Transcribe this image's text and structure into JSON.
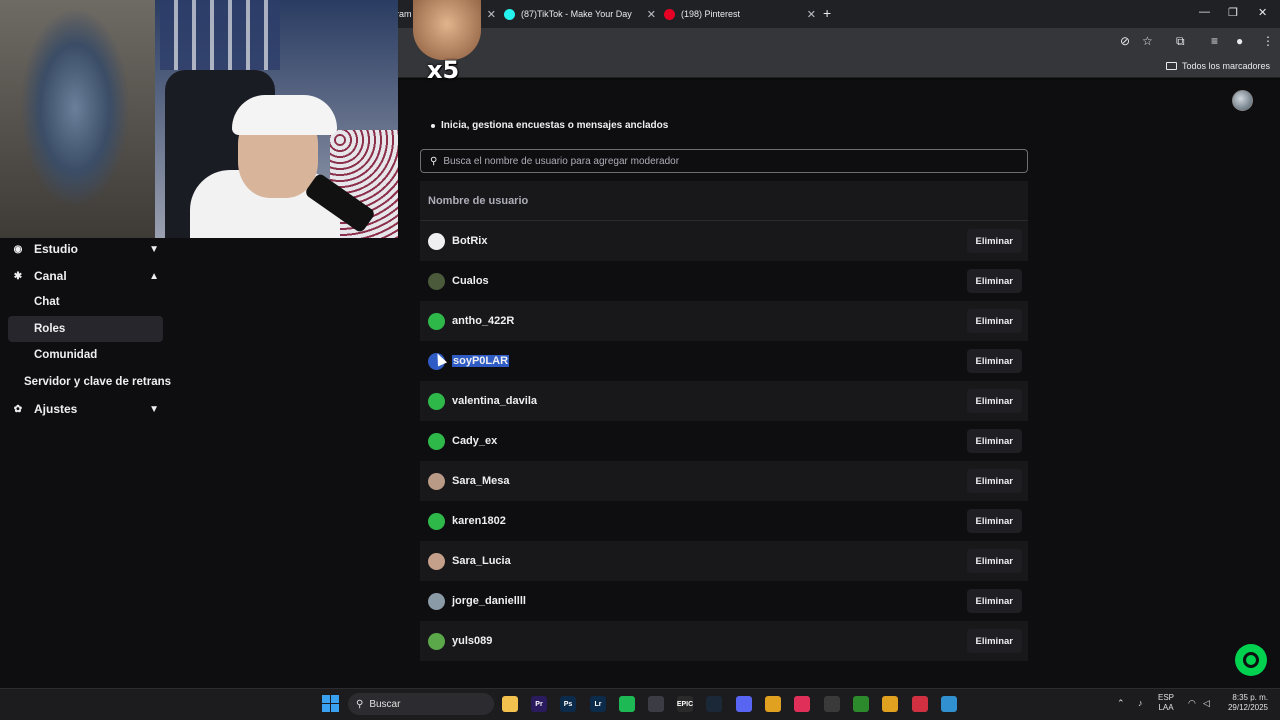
{
  "browser": {
    "tabs": [
      {
        "title": "ram",
        "icon": "tab-icon"
      },
      {
        "title": "(87)TikTok - Make Your Day",
        "icon": "tiktok-icon"
      },
      {
        "title": "(198) Pinterest",
        "icon": "pinterest-icon"
      }
    ],
    "bookmarks_label": "Todos los marcadores"
  },
  "overlay": {
    "emote_multiplier": "x5"
  },
  "sidebar": {
    "items": [
      {
        "label": "Estudio",
        "icon": "studio-icon",
        "expanded": false
      },
      {
        "label": "Canal",
        "icon": "channel-icon",
        "expanded": true
      },
      {
        "label": "Chat"
      },
      {
        "label": "Roles",
        "selected": true
      },
      {
        "label": "Comunidad"
      },
      {
        "label": "Servidor y clave de retrans"
      },
      {
        "label": "Ajustes",
        "icon": "gear-icon",
        "expanded": false
      }
    ]
  },
  "content": {
    "bullet": "Inicia, gestiona encuestas o mensajes anclados",
    "search_placeholder": "Busca el nombre de usuario para agregar moderador",
    "column_header": "Nombre de usuario",
    "remove_label": "Eliminar",
    "moderators": [
      {
        "name": "BotRix",
        "avatar_color": "#efeff1"
      },
      {
        "name": "Cualos",
        "avatar_color": "#4a5a3a"
      },
      {
        "name": "antho_422R",
        "avatar_color": "#2fb84a"
      },
      {
        "name": "soyP0LAR",
        "avatar_color": "#2e5cc4",
        "selected": true
      },
      {
        "name": "valentina_davila",
        "avatar_color": "#2fb84a"
      },
      {
        "name": "Cady_ex",
        "avatar_color": "#2fb84a"
      },
      {
        "name": "Sara_Mesa",
        "avatar_color": "#b89a86"
      },
      {
        "name": "karen1802",
        "avatar_color": "#2fb84a"
      },
      {
        "name": "Sara_Lucia",
        "avatar_color": "#c4a08a"
      },
      {
        "name": "jorge_daniellll",
        "avatar_color": "#8a9aa6"
      },
      {
        "name": "yuls089",
        "avatar_color": "#5aa84a"
      }
    ]
  },
  "taskbar": {
    "search_label": "Buscar",
    "language": "ESP",
    "language_sub": "LAA",
    "time": "8:35 p. m.",
    "date": "29/12/2025",
    "apps": [
      {
        "name": "file-explorer-icon",
        "label": "",
        "color": "#f2c14e"
      },
      {
        "name": "premiere-icon",
        "label": "Pr",
        "color": "#2a1a5e"
      },
      {
        "name": "photoshop-icon",
        "label": "Ps",
        "color": "#0c2a4a"
      },
      {
        "name": "lightroom-icon",
        "label": "Lr",
        "color": "#0c2a4a"
      },
      {
        "name": "spotify-icon",
        "label": "",
        "color": "#1db954"
      },
      {
        "name": "app-icon",
        "label": "",
        "color": "#3c3c44"
      },
      {
        "name": "epic-games-icon",
        "label": "EPIC",
        "color": "#2a2a2a"
      },
      {
        "name": "steam-icon",
        "label": "",
        "color": "#1b2838"
      },
      {
        "name": "discord-icon",
        "label": "",
        "color": "#5865f2"
      },
      {
        "name": "chrome-icon",
        "label": "",
        "color": "#e0a020"
      },
      {
        "name": "tiktok-app-icon",
        "label": "",
        "color": "#e0305a"
      },
      {
        "name": "obs-icon",
        "label": "",
        "color": "#3a3a3a"
      },
      {
        "name": "xbox-icon",
        "label": "",
        "color": "#2c8a2c"
      },
      {
        "name": "chrome-profile-icon",
        "label": "",
        "color": "#e0a020"
      },
      {
        "name": "app-red-icon",
        "label": "",
        "color": "#d03040"
      },
      {
        "name": "app-blue-icon",
        "label": "",
        "color": "#3090d0"
      }
    ]
  }
}
